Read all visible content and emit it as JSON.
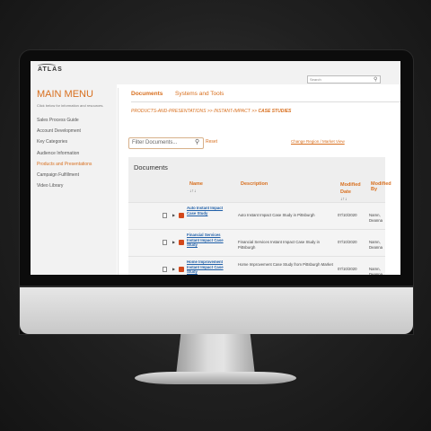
{
  "app": {
    "logo_text": "ATLAS"
  },
  "search": {
    "placeholder": "Search"
  },
  "sidebar": {
    "title": "MAIN MENU",
    "subtitle": "Click below for information and resources.",
    "items": [
      {
        "label": "Sales Process Guide",
        "active": false
      },
      {
        "label": "Account Development",
        "active": false
      },
      {
        "label": "Key Categories",
        "active": false
      },
      {
        "label": "Audience Information",
        "active": false
      },
      {
        "label": "Products and Presentations",
        "active": true
      },
      {
        "label": "Campaign Fulfillment",
        "active": false
      },
      {
        "label": "Video Library",
        "active": false
      }
    ]
  },
  "tabs": [
    {
      "label": "Documents",
      "active": true
    },
    {
      "label": "Systems and Tools",
      "active": false
    }
  ],
  "breadcrumb": {
    "part1": "PRODUCTS-AND-PRESENTATIONS",
    "sep": ">>",
    "part2": "INSTANT-IMPACT",
    "part3": "CASE STUDIES"
  },
  "filter": {
    "placeholder": "Filter Documents...",
    "reset_label": "Reset"
  },
  "change_view_label": "Change Region / Market View",
  "documents": {
    "title": "Documents",
    "columns": {
      "name": "Name",
      "description": "Description",
      "modified_date": "Modified Date",
      "modified_by": "Modified By"
    },
    "sort_glyph": "↓↑↓",
    "rows": [
      {
        "name": "Auto Instant Impact Case Study",
        "description": "Auto Instant Impact Case Study in Pittsburgh",
        "modified_date": "07/10/2020",
        "modified_by": "Namn, Deanna"
      },
      {
        "name": "Financial Services Instant Impact Case Study",
        "description": "Financial Services Instant Impact Case Study in Pittsburgh",
        "modified_date": "07/10/2020",
        "modified_by": "Namn, Deanna"
      },
      {
        "name": "Home Improvement Instant Impact Case Study",
        "description": "Home Improvement Case Study from Pittsburgh Market",
        "modified_date": "07/10/2020",
        "modified_by": "Namn, Deanna"
      }
    ]
  },
  "colors": {
    "accent": "#d86f1e",
    "link": "#1f5fa8",
    "ppt": "#d2481b"
  }
}
